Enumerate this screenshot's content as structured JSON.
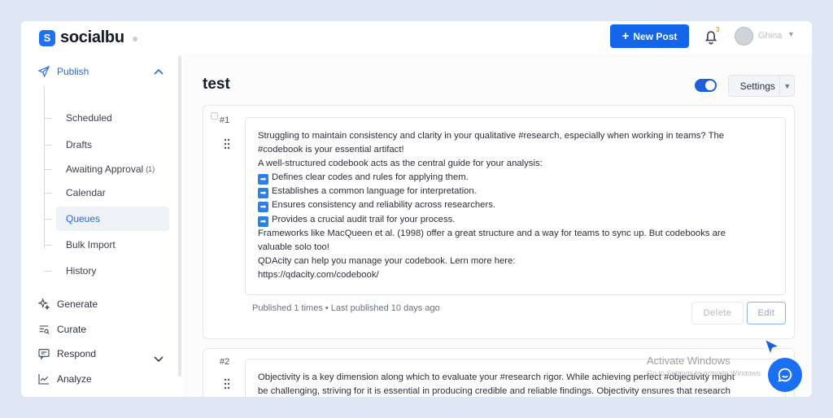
{
  "app": {
    "name": "socialbu"
  },
  "header": {
    "new_post_label": "New Post",
    "notification_count": "3",
    "user_name": "Ghina"
  },
  "sidebar": {
    "publish_label": "Publish",
    "sub_items": [
      {
        "label": "Scheduled",
        "count": ""
      },
      {
        "label": "Drafts",
        "count": ""
      },
      {
        "label": "Awaiting Approval",
        "count": "(1)"
      },
      {
        "label": "Calendar",
        "count": ""
      },
      {
        "label": "Queues",
        "count": ""
      },
      {
        "label": "Bulk Import",
        "count": ""
      },
      {
        "label": "History",
        "count": ""
      }
    ],
    "active_item": "Queues",
    "main_items": [
      {
        "label": "Generate",
        "icon": "sparkle-icon"
      },
      {
        "label": "Curate",
        "icon": "curate-icon"
      },
      {
        "label": "Respond",
        "icon": "message-icon"
      },
      {
        "label": "Analyze",
        "icon": "chart-icon"
      }
    ]
  },
  "main": {
    "title": "test",
    "queue_enabled": true,
    "settings_label": "Settings",
    "posts": [
      {
        "number": "#1",
        "lines": [
          "Struggling to maintain consistency and clarity in your qualitative #research, especially when working in teams? The",
          "#codebook is your essential artifact!",
          "A well-structured codebook acts as the central guide for your analysis:",
          "Defines clear codes and rules for applying them.",
          "Establishes a common language for interpretation.",
          "Ensures consistency and reliability across researchers.",
          "Provides a crucial audit trail for your process.",
          "Frameworks like MacQueen et al. (1998) offer a great structure and a way for teams to sync up. But codebooks are",
          "valuable solo too!",
          "QDAcity can help you manage your codebook. Lern more here:",
          "https://qdacity.com/codebook/"
        ],
        "meta": "Published 1 times • Last published 10 days ago",
        "delete_label": "Delete",
        "edit_label": "Edit"
      },
      {
        "number": "#2",
        "lines": [
          "Objectivity is a key dimension along which to evaluate your #research rigor. While achieving perfect #objectivity might",
          "be challenging, striving for it is essential in producing credible and reliable findings. Objectivity ensures that research"
        ]
      }
    ]
  },
  "overlay": {
    "watermark_title": "Activate Windows",
    "watermark_sub": "Go to Settings to activate Windows."
  },
  "colors": {
    "accent": "#1565e8",
    "background": "#dfe7f5"
  }
}
